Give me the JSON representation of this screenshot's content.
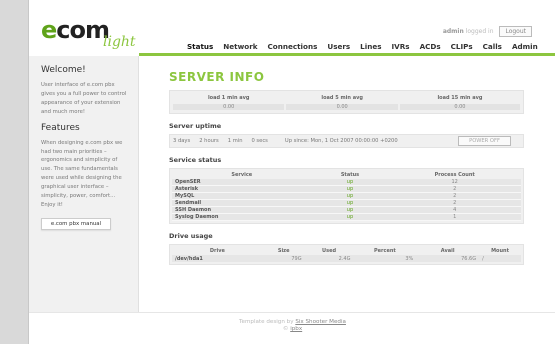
{
  "header": {
    "logo_prefix": "e",
    "logo_rest": "com",
    "logo_sub": "light",
    "user": "admin",
    "logged_text": "logged in",
    "logout": "Logout"
  },
  "nav": [
    "Status",
    "Network",
    "Connections",
    "Users",
    "Lines",
    "IVRs",
    "ACDs",
    "CLIPs",
    "Calls",
    "Admin"
  ],
  "sidebar": {
    "welcome_title": "Welcome!",
    "welcome_text": "User interface of e.com pbx gives you a full power to control appearance of your extension and much more!",
    "features_title": "Features",
    "features_text": "When designing e.com pbx we had two main priorities – ergonomics and simplicity of use. The same fundamentals were used while designing the graphical user interface – simplicity, power, comfort... Enjoy it!",
    "manual_button": "e.com pbx manual"
  },
  "main": {
    "title": "SERVER INFO",
    "load": {
      "headers": [
        "load 1 min avg",
        "load 5 min avg",
        "load 15 min avg"
      ],
      "values": [
        "0.00",
        "0.00",
        "0.00"
      ]
    },
    "uptime": {
      "title": "Server uptime",
      "days": "3 days",
      "hours": "2 hours",
      "mins": "1 min",
      "secs": "0 secs",
      "since": "Up since: Mon, 1 Oct 2007 00:00:00 +0200",
      "power_off": "POWER OFF"
    },
    "services": {
      "title": "Service status",
      "headers": [
        "Service",
        "Status",
        "Process Count"
      ],
      "rows": [
        {
          "name": "OpenSER",
          "status": "up",
          "count": "12"
        },
        {
          "name": "Asterisk",
          "status": "up",
          "count": "2"
        },
        {
          "name": "MySQL",
          "status": "up",
          "count": "2"
        },
        {
          "name": "Sendmail",
          "status": "up",
          "count": "2"
        },
        {
          "name": "SSH Daemon",
          "status": "up",
          "count": "4"
        },
        {
          "name": "Syslog Daemon",
          "status": "up",
          "count": "1"
        }
      ]
    },
    "drives": {
      "title": "Drive usage",
      "headers": [
        "Drive",
        "Size",
        "Used",
        "Percent",
        "Avail",
        "Mount"
      ],
      "rows": [
        {
          "drive": "/dev/hda1",
          "size": "79G",
          "used": "2.4G",
          "percent": "3%",
          "avail": "76.6G",
          "mount": "/"
        }
      ]
    }
  },
  "footer": {
    "prefix": "Template design by",
    "designer": "Six Shooter Media",
    "copyright": "©",
    "company": "ipbx"
  }
}
